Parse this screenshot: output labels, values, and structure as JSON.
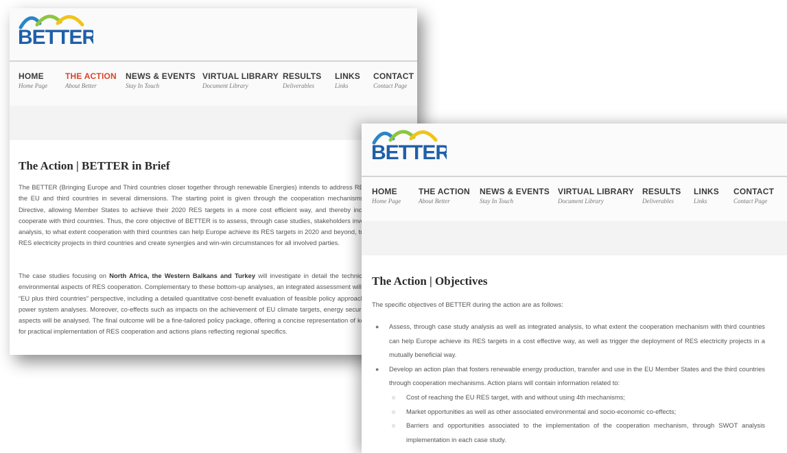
{
  "brand": {
    "name": "BETTER",
    "colors": {
      "arc_blue": "#2a86c8",
      "arc_green": "#8cc63f",
      "arc_yellow": "#f2c318",
      "text_blue": "#1f5fa8",
      "active_nav": "#d8442b"
    }
  },
  "nav": [
    {
      "label": "HOME",
      "sub": "Home Page"
    },
    {
      "label": "THE ACTION",
      "sub": "About Better"
    },
    {
      "label": "NEWS & EVENTS",
      "sub": "Stay In Touch"
    },
    {
      "label": "VIRTUAL LIBRARY",
      "sub": "Document Library"
    },
    {
      "label": "RESULTS",
      "sub": "Deliverables"
    },
    {
      "label": "LINKS",
      "sub": "Links"
    },
    {
      "label": "CONTACT",
      "sub": "Contact Page"
    }
  ],
  "page1": {
    "title": "The Action | BETTER in Brief",
    "p1": "The BETTER (Bringing Europe and Third countries closer together through renewable Energies) intends to address RES cooperation between the EU and third countries in several dimensions. The starting point is given through the cooperation mechanisms provided by the RES Directive, allowing Member States to achieve their 2020 RES targets in a more cost efficient way, and thereby including the possibility to cooperate with third countries. Thus, the core objective of BETTER is to assess, through case studies, stakeholders involvement and integrated analysis, to what extent cooperation with third countries can help Europe achieve its RES targets in 2020 and beyond, trigger the deployment of RES electricity projects in third countries and create synergies and win-win circumstances for all involved parties.",
    "p2_pre": "The case studies focusing on ",
    "p2_bold": "North Africa, the Western Balkans and Turkey",
    "p2_post": " will investigate in detail the technical, socio-economic and environmental aspects of RES cooperation. Complementary to these bottom-up analyses, an integrated assessment will be undertaken from the “EU plus third countries” perspective, including a detailed quantitative cost-benefit evaluation of feasible policy approaches, as well as strategic power system analyses. Moreover, co-effects such as impacts on the achievement of EU climate targets, energy security and macro-economic aspects will be analysed. The final outcome will be a fine-tailored policy package, offering a concise representation of key outcomes, guidelines for practical implementation of RES cooperation and actions plans reflecting regional specifics."
  },
  "page2": {
    "title": "The Action | Objectives",
    "intro": "The specific objectives of BETTER during the action are as follows:",
    "bullet1": "Assess, through case study analysis as well as integrated analysis, to what extent the cooperation mechanism with third countries can help Europe achieve its RES targets in a cost effective way, as well as trigger the deployment of RES electricity projects in a mutually beneficial way.",
    "bullet2": "Develop an action plan that fosters renewable energy production, transfer and use in the EU Member States and the third countries through cooperation mechanisms. Action plans will contain information related to:",
    "sub1": "Cost of reaching the EU RES target, with and without using 4th mechanisms;",
    "sub2": "Market opportunities as well as other associated environmental and socio-economic co-effects;",
    "sub3": "Barriers and opportunities associated to the implementation of the cooperation mechanism, through SWOT analysis implementation in each case study."
  }
}
